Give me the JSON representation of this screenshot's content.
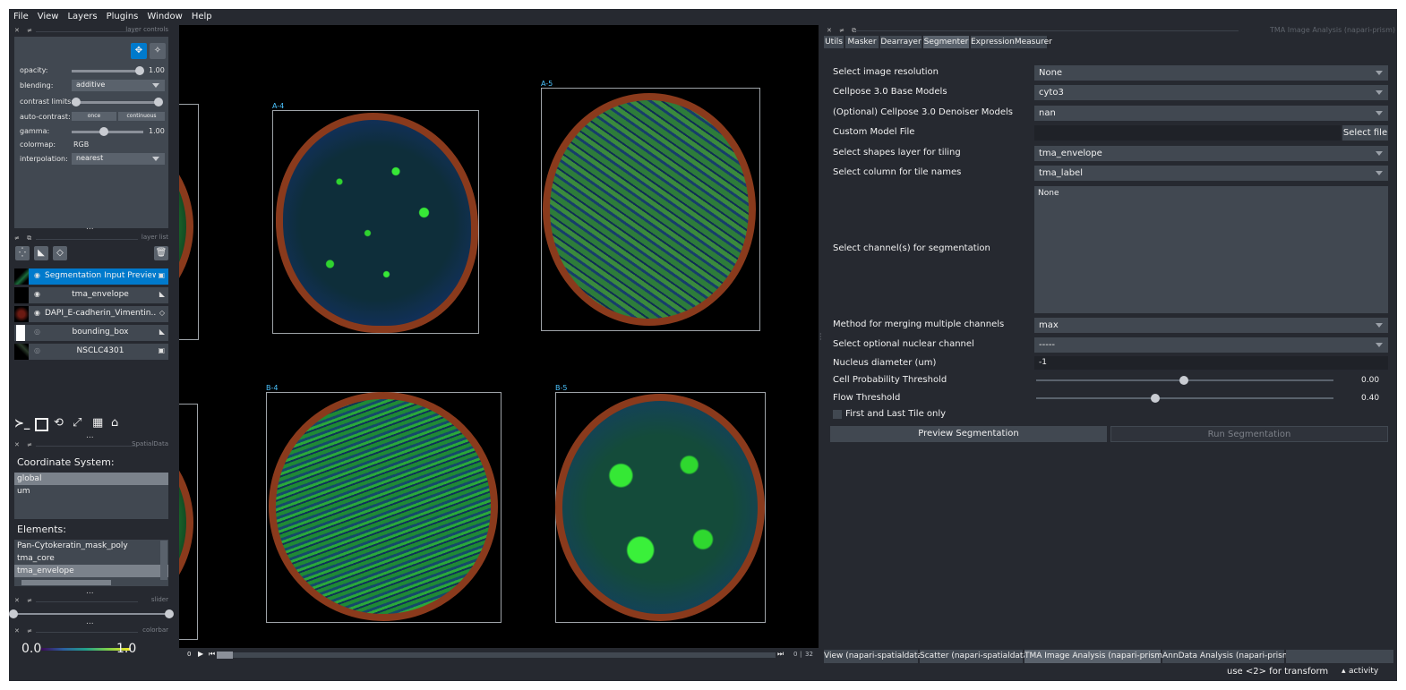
{
  "menubar": [
    "File",
    "View",
    "Layers",
    "Plugins",
    "Window",
    "Help"
  ],
  "layer_controls": {
    "title": "layer controls",
    "opacity_label": "opacity:",
    "opacity_value": "1.00",
    "blending_label": "blending:",
    "blending_value": "additive",
    "contrast_label": "contrast limits:",
    "autocontrast_label": "auto-contrast:",
    "once_label": "once",
    "continuous_label": "continuous",
    "gamma_label": "gamma:",
    "gamma_value": "1.00",
    "colormap_label": "colormap:",
    "colormap_value": "RGB",
    "interpolation_label": "interpolation:",
    "interpolation_value": "nearest",
    "dots": "..."
  },
  "layer_list": {
    "title": "layer list",
    "layers": [
      {
        "name": "Segmentation Input Preview",
        "selected": true
      },
      {
        "name": "tma_envelope",
        "selected": false
      },
      {
        "name": "DAPI_E-cadherin_Vimentin...",
        "selected": false
      },
      {
        "name": "bounding_box",
        "selected": false
      },
      {
        "name": "NSCLC4301",
        "selected": false
      }
    ]
  },
  "spatialdata": {
    "dots": "...",
    "title": "SpatialData",
    "coordinate_label": "Coordinate System:",
    "coordinates": [
      "global",
      "um"
    ],
    "elements_label": "Elements:",
    "elements": [
      "Pan-Cytokeratin_mask_poly",
      "tma_core",
      "tma_envelope"
    ]
  },
  "slider_dock": {
    "dots": "...",
    "title": "slider"
  },
  "colorbar": {
    "dots": "...",
    "title": "colorbar",
    "min": "0.0",
    "max": "1.0"
  },
  "canvas": {
    "tiles": [
      {
        "label": "A-4",
        "style": "speckle"
      },
      {
        "label": "A-5",
        "style": "folds"
      },
      {
        "label": "B-4",
        "style": "fiber"
      },
      {
        "label": "B-5",
        "style": "blob"
      }
    ],
    "colors": {
      "background": "#000000",
      "envelope": "#8a3a1c",
      "tissue": "#23a53a",
      "label": "#4cc4ff"
    }
  },
  "time_slider": {
    "start": "0",
    "current": "0",
    "total": "32"
  },
  "right_panel": {
    "title": "TMA Image Analysis (napari-prism)",
    "tabs": [
      "Utils",
      "Masker",
      "Dearrayer",
      "Segmenter",
      "ExpressionMeasurer"
    ],
    "active_tab": "Segmenter",
    "fields": {
      "resolution_label": "Select image resolution",
      "resolution_value": "None",
      "base_models_label": "Cellpose 3.0 Base Models",
      "base_models_value": "cyto3",
      "denoiser_label": "(Optional) Cellpose 3.0 Denoiser Models",
      "denoiser_value": "nan",
      "custom_model_label": "Custom Model File",
      "select_file_label": "Select file",
      "shapes_layer_label": "Select shapes layer for tiling",
      "shapes_layer_value": "tma_envelope",
      "tile_names_label": "Select column for tile names",
      "tile_names_value": "tma_label",
      "channels_label": "Select channel(s) for segmentation",
      "channels_value": "None",
      "merge_label": "Method for merging multiple channels",
      "merge_value": "max",
      "nuclear_label": "Select optional nuclear channel",
      "nuclear_value": "-----",
      "nucleus_diam_label": "Nucleus diameter (um)",
      "nucleus_diam_value": "-1",
      "cellprob_label": "Cell Probability Threshold",
      "cellprob_value": "0.00",
      "flow_label": "Flow Threshold",
      "flow_value": "0.40",
      "first_last_label": "First and Last Tile only",
      "preview_label": "Preview Segmentation",
      "run_label": "Run Segmentation"
    }
  },
  "bottom_tabs": [
    "View (napari-spatialdata)",
    "Scatter (napari-spatialdata)",
    "TMA Image Analysis (napari-prism)",
    "AnnData Analysis (napari-prism)"
  ],
  "status": {
    "hint": "use <2> for transform",
    "activity": "activity"
  }
}
